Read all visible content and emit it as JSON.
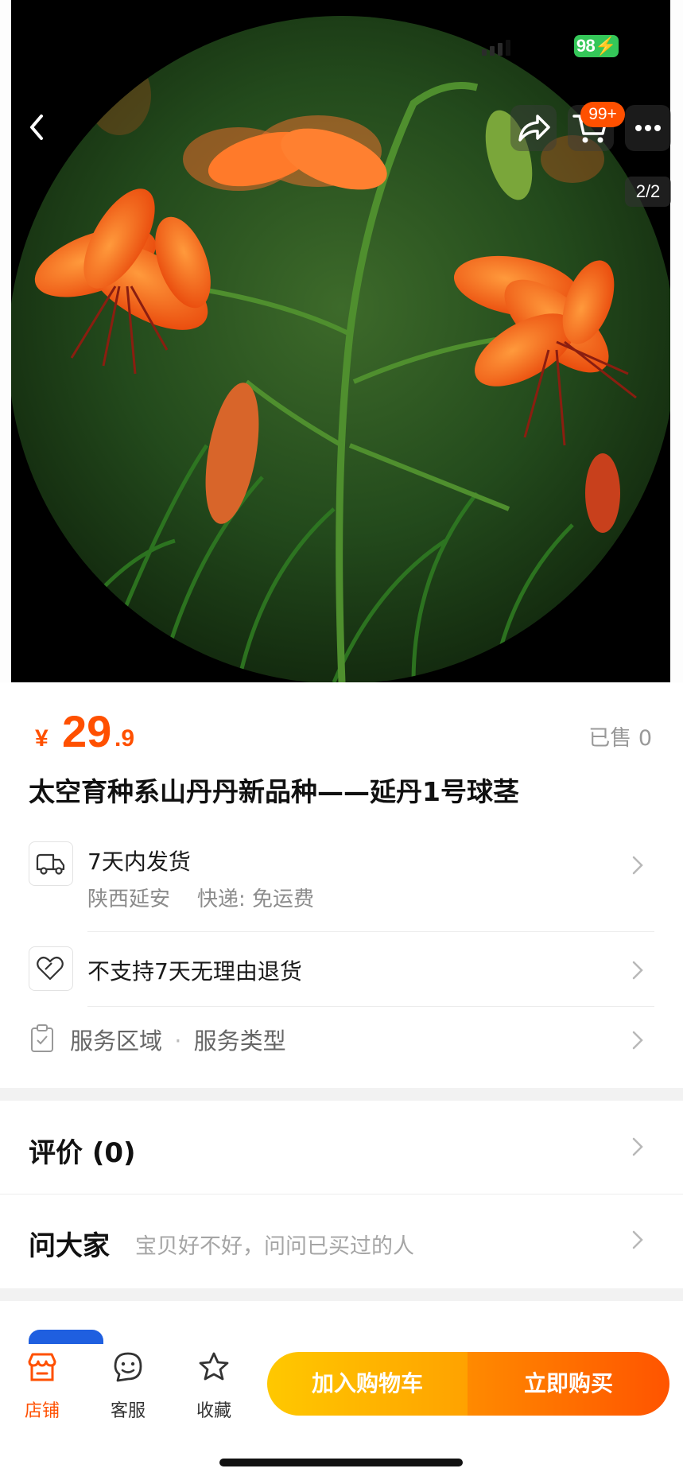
{
  "status_bar": {
    "battery": "98⚡"
  },
  "gallery": {
    "cart_badge": "99+",
    "counter": "2/2"
  },
  "product": {
    "price_symbol": "¥",
    "price_integer": "29",
    "price_decimal": ".9",
    "sold": "已售 0",
    "title": "太空育种系山丹丹新品种——延丹1号球茎"
  },
  "shipping": {
    "title": "7天内发货",
    "origin": "陕西延安",
    "delivery": "快递: 免运费"
  },
  "returns": {
    "title": "不支持7天无理由退货"
  },
  "service": {
    "area": "服务区域",
    "separator": "·",
    "type": "服务类型"
  },
  "reviews": {
    "label": "评价 (0)"
  },
  "questions": {
    "label": "问大家",
    "hint": "宝贝好不好，问问已买过的人"
  },
  "bottom_bar": {
    "store": "店铺",
    "customer_service": "客服",
    "favorite": "收藏",
    "add_to_cart": "加入购物车",
    "buy_now": "立即购买"
  },
  "colors": {
    "accent": "#ff5000",
    "cart_button": "#ffb400",
    "buy_button": "#ff6a00",
    "battery": "#35c759"
  },
  "icons": [
    "back-icon",
    "share-icon",
    "cart-icon",
    "more-icon",
    "truck-icon",
    "heart-tag-icon",
    "clipboard-icon",
    "chevron-right-icon",
    "store-icon",
    "service-face-icon",
    "star-icon"
  ]
}
